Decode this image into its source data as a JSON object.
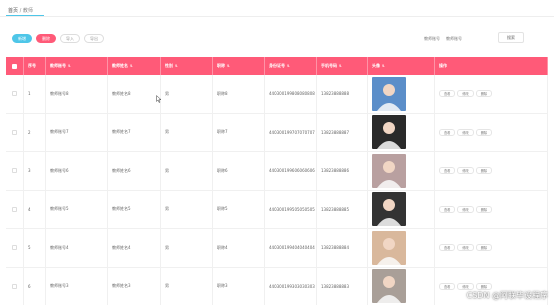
{
  "breadcrumb": {
    "home": "首页",
    "sep": " / ",
    "current": "教师"
  },
  "toolbar": {
    "add": "新增",
    "delete": "删除",
    "import": "导入",
    "export": "导出"
  },
  "search": {
    "label": "教师账号",
    "placeholder": "教师账号",
    "button": "搜索"
  },
  "table": {
    "headers": [
      "",
      "序号",
      "教师账号",
      "教师姓名",
      "性别",
      "职称",
      "身份证号",
      "手机号码",
      "头像",
      "操作"
    ],
    "actions": [
      "查看",
      "修改",
      "删除"
    ],
    "rows": [
      {
        "no": "1",
        "account": "教师账号8",
        "name": "教师姓名8",
        "gender": "男",
        "title": "职称8",
        "id": "440300199808080808",
        "phone": "13823888888",
        "avatar_color": "#5b8ec9"
      },
      {
        "no": "2",
        "account": "教师账号7",
        "name": "教师姓名7",
        "gender": "男",
        "title": "职称7",
        "id": "440300199707070707",
        "phone": "13823888887",
        "avatar_color": "#2a2a2a"
      },
      {
        "no": "3",
        "account": "教师账号6",
        "name": "教师姓名6",
        "gender": "男",
        "title": "职称6",
        "id": "440300199606060606",
        "phone": "13823888886",
        "avatar_color": "#b9a0a0"
      },
      {
        "no": "4",
        "account": "教师账号5",
        "name": "教师姓名5",
        "gender": "男",
        "title": "职称5",
        "id": "440300199505050505",
        "phone": "13823888885",
        "avatar_color": "#333333"
      },
      {
        "no": "5",
        "account": "教师账号4",
        "name": "教师姓名4",
        "gender": "男",
        "title": "职称4",
        "id": "440300199404040404",
        "phone": "13823888884",
        "avatar_color": "#d9b89c"
      },
      {
        "no": "6",
        "account": "教师账号3",
        "name": "教师姓名3",
        "gender": "男",
        "title": "职称3",
        "id": "440300199303030303",
        "phone": "13823888883",
        "avatar_color": "#a99f98"
      }
    ]
  },
  "watermark": "CSDN @阿联毕设程序"
}
